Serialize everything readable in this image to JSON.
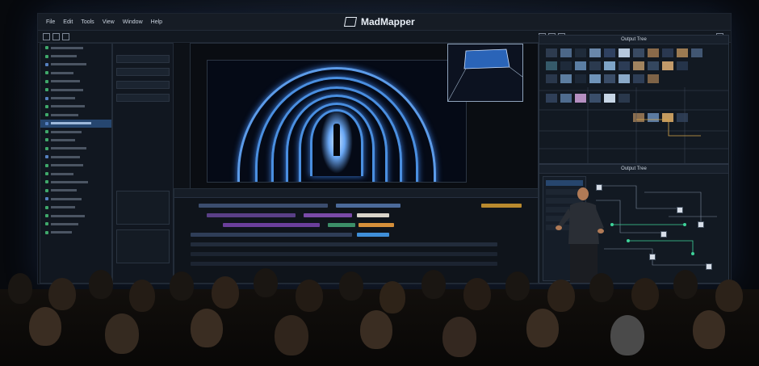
{
  "app": {
    "title": "MadMapper",
    "menu": [
      "File",
      "Edit",
      "Tools",
      "View",
      "Window",
      "Help"
    ]
  },
  "panels": {
    "output_top_title": "Output Tree",
    "output_bottom_title": "Output Tree"
  },
  "colors": {
    "accent": "#4a8fe0",
    "selection": "#26466f",
    "node_green": "#3ed39a",
    "screen_bg": "#0d1117"
  },
  "icons": [
    "logo-icon",
    "tunnel-video",
    "presenter-photo",
    "audience-photo"
  ]
}
